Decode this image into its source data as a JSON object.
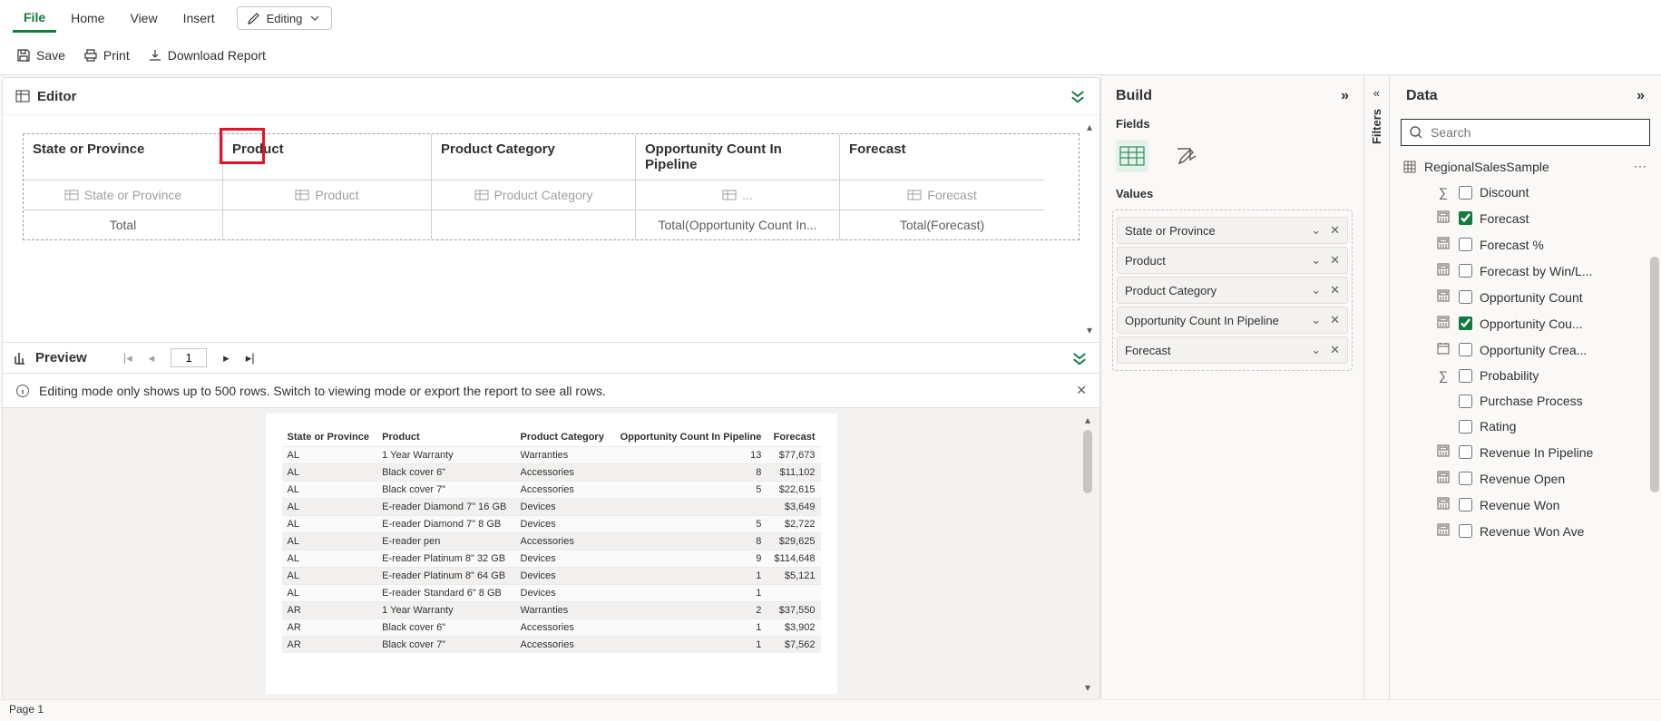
{
  "ribbon": {
    "tabs": [
      "File",
      "Home",
      "View",
      "Insert"
    ],
    "activeTab": "File",
    "editingLabel": "Editing",
    "actions": {
      "save": "Save",
      "print": "Print",
      "download": "Download Report"
    }
  },
  "editor": {
    "title": "Editor",
    "headers": [
      "State or Province",
      "Product",
      "Product Category",
      "Opportunity Count In Pipeline",
      "Forecast"
    ],
    "placeholders": [
      "State or Province",
      "Product",
      "Product Category",
      "...",
      "Forecast"
    ],
    "totals": [
      "Total",
      "",
      "",
      "Total(Opportunity Count In...",
      "Total(Forecast)"
    ]
  },
  "preview": {
    "title": "Preview",
    "page": "1",
    "info": "Editing mode only shows up to 500 rows. Switch to viewing mode or export the report to see all rows.",
    "columns": [
      "State or Province",
      "Product",
      "Product Category",
      "Opportunity Count In Pipeline",
      "Forecast"
    ],
    "rows": [
      [
        "AL",
        "1 Year Warranty",
        "Warranties",
        "13",
        "$77,673"
      ],
      [
        "AL",
        "Black cover 6\"",
        "Accessories",
        "8",
        "$11,102"
      ],
      [
        "AL",
        "Black cover 7\"",
        "Accessories",
        "5",
        "$22,615"
      ],
      [
        "AL",
        "E-reader Diamond 7\" 16 GB",
        "Devices",
        "",
        "$3,649"
      ],
      [
        "AL",
        "E-reader Diamond 7\" 8 GB",
        "Devices",
        "5",
        "$2,722"
      ],
      [
        "AL",
        "E-reader pen",
        "Accessories",
        "8",
        "$29,625"
      ],
      [
        "AL",
        "E-reader Platinum 8\" 32 GB",
        "Devices",
        "9",
        "$114,648"
      ],
      [
        "AL",
        "E-reader Platinum 8\" 64 GB",
        "Devices",
        "1",
        "$5,121"
      ],
      [
        "AL",
        "E-reader Standard 6\" 8 GB",
        "Devices",
        "1",
        ""
      ],
      [
        "AR",
        "1 Year Warranty",
        "Warranties",
        "2",
        "$37,550"
      ],
      [
        "AR",
        "Black cover 6\"",
        "Accessories",
        "1",
        "$3,902"
      ],
      [
        "AR",
        "Black cover 7\"",
        "Accessories",
        "1",
        "$7,562"
      ]
    ]
  },
  "build": {
    "title": "Build",
    "fieldsLabel": "Fields",
    "valuesLabel": "Values",
    "values": [
      "State or Province",
      "Product",
      "Product Category",
      "Opportunity Count In Pipeline",
      "Forecast"
    ]
  },
  "filters": {
    "label": "Filters"
  },
  "data": {
    "title": "Data",
    "searchPlaceholder": "Search",
    "dataset": "RegionalSalesSample",
    "fields": [
      {
        "icon": "sigma",
        "label": "Discount",
        "checked": false
      },
      {
        "icon": "calc",
        "label": "Forecast",
        "checked": true
      },
      {
        "icon": "calc",
        "label": "Forecast %",
        "checked": false
      },
      {
        "icon": "calc",
        "label": "Forecast by Win/L...",
        "checked": false
      },
      {
        "icon": "calc",
        "label": "Opportunity Count",
        "checked": false
      },
      {
        "icon": "calc",
        "label": "Opportunity Cou...",
        "checked": true
      },
      {
        "icon": "date",
        "label": "Opportunity Crea...",
        "checked": false
      },
      {
        "icon": "sigma",
        "label": "Probability",
        "checked": false
      },
      {
        "icon": "none",
        "label": "Purchase Process",
        "checked": false
      },
      {
        "icon": "none",
        "label": "Rating",
        "checked": false
      },
      {
        "icon": "calc",
        "label": "Revenue In Pipeline",
        "checked": false
      },
      {
        "icon": "calc",
        "label": "Revenue Open",
        "checked": false
      },
      {
        "icon": "calc",
        "label": "Revenue Won",
        "checked": false
      },
      {
        "icon": "calc",
        "label": "Revenue Won Ave",
        "checked": false
      }
    ]
  },
  "footer": {
    "page": "Page 1"
  }
}
